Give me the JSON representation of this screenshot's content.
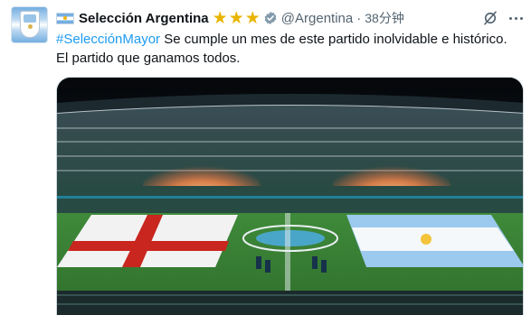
{
  "author": {
    "display_name": "Selección Argentina",
    "handle": "@Argentina",
    "separator": "·",
    "timestamp": "38分钟",
    "avatar_icon": "afa-crest-icon",
    "flag_icon": "argentina-flag-icon",
    "badges": [
      "star-icon",
      "star-icon",
      "star-icon"
    ],
    "verified_icon": "verified-badge-icon"
  },
  "tweet": {
    "hashtag": "#SelecciónMayor",
    "body_line1": " Se cumple un mes de este partido inolvidable e histórico.",
    "body_line2": "El partido que ganamos todos."
  },
  "actions": {
    "grok_icon": "grok-icon",
    "more_icon": "more-options-icon"
  },
  "media": {
    "type": "image",
    "description_icon": "stadium-photo"
  },
  "colors": {
    "link": "#1d9bf0",
    "secondary_text": "#536471",
    "star": "#e8b400",
    "verified": "#829aab"
  }
}
